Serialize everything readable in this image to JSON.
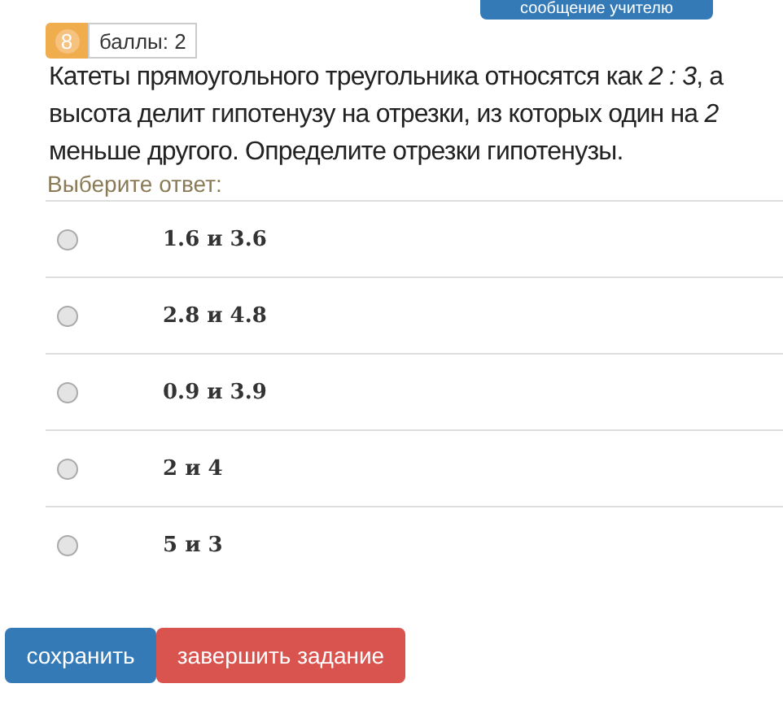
{
  "message_button": {
    "label": "сообщение учителю"
  },
  "badge": {
    "number": "8",
    "label": "баллы: 2"
  },
  "question": "Катеты прямоугольного треугольника относятся как *2 : 3*, а высота делит гипотенузу на отрезки, из которых один на *2* меньше другого. Определите отрезки гипотенузы.",
  "prompt": "Выберите ответ:",
  "options": [
    {
      "label": "1.6 и 3.6",
      "selected": false
    },
    {
      "label": "2.8 и 4.8",
      "selected": false
    },
    {
      "label": "0.9 и 3.9",
      "selected": false
    },
    {
      "label": "2 и 4",
      "selected": false
    },
    {
      "label": "5 и 3",
      "selected": false
    }
  ],
  "buttons": [
    {
      "label": "сохранить",
      "kind": "primary"
    },
    {
      "label": "завершить задание",
      "kind": "danger"
    }
  ]
}
